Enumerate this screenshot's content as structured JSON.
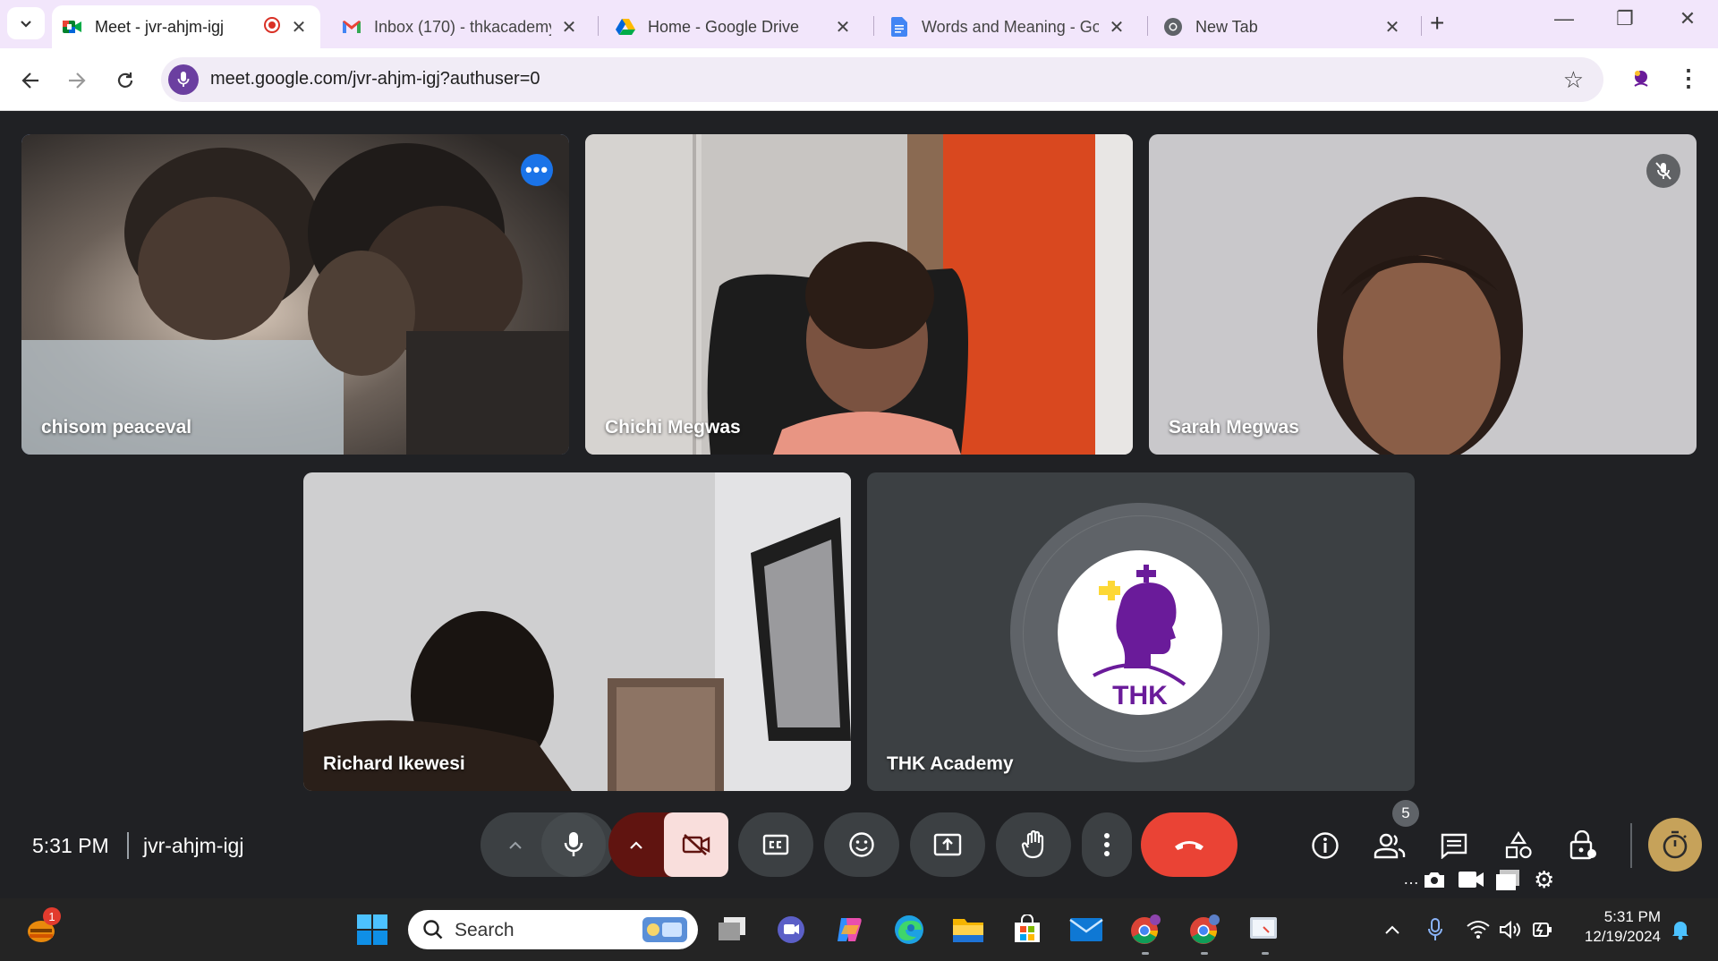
{
  "browser": {
    "tabs": [
      {
        "title": "Meet - jvr-ahjm-igj",
        "favicon": "google-meet-icon",
        "recording": true,
        "active": true
      },
      {
        "title": "Inbox (170) - thkacademy",
        "favicon": "gmail-icon",
        "active": false
      },
      {
        "title": "Home - Google Drive",
        "favicon": "google-drive-icon",
        "active": false
      },
      {
        "title": "Words and Meaning - Go",
        "favicon": "google-docs-icon",
        "active": false
      },
      {
        "title": "New Tab",
        "favicon": "chrome-icon",
        "active": false
      }
    ],
    "url": "meet.google.com/jvr-ahjm-igj?authuser=0"
  },
  "meet": {
    "participants": [
      {
        "name": "chisom peaceval",
        "active_speaker": true,
        "has_menu": true
      },
      {
        "name": "Chichi Megwas",
        "active_speaker": false
      },
      {
        "name": "Sarah Megwas",
        "muted": true
      },
      {
        "name": "Richard Ikewesi"
      },
      {
        "name": "THK Academy",
        "camera_off": true,
        "avatar_text": "THK"
      }
    ],
    "time": "5:31 PM",
    "meeting_code": "jvr-ahjm-igj",
    "people_count": "5",
    "colors": {
      "end_call": "#ea4335",
      "cam_off_bg": "#f9dedc",
      "cam_split_bg": "#601410",
      "active_outline": "#8ab4f8"
    }
  },
  "taskbar": {
    "search_label": "Search",
    "widget_badge": "1",
    "clock_time": "5:31 PM",
    "clock_date": "12/19/2024"
  }
}
